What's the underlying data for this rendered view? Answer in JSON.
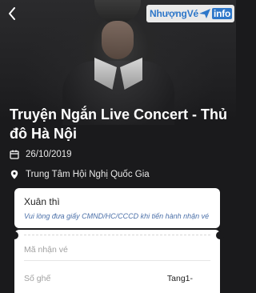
{
  "watermark": {
    "part1": "Nhượng",
    "part2": "Vé",
    "part3": "info"
  },
  "event": {
    "title": "Truyện Ngắn Live Concert - Thủ đô Hà Nội",
    "date": "26/10/2019",
    "venue": "Trung Tâm Hội Nghị Quốc Gia"
  },
  "form": {
    "name_value": "Xuân thì",
    "hint": "Vui lòng đưa giấy CMND/HC/CCCD khi tiến hành nhận vé",
    "ticket_code_placeholder": "Mã nhận vé",
    "seat_label": "Số ghế",
    "seat_value": "Tang1-"
  }
}
